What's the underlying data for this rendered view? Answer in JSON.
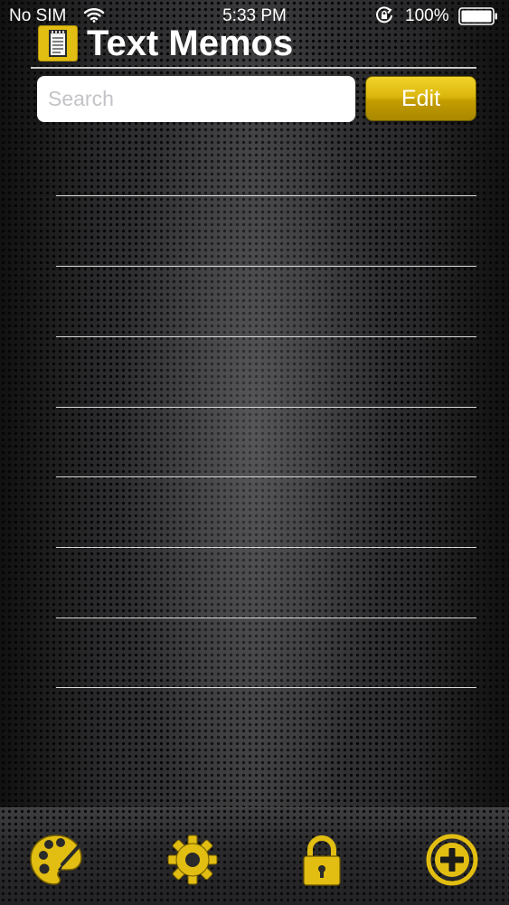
{
  "status_bar": {
    "carrier": "No SIM",
    "time": "5:33 PM",
    "battery": "100%",
    "icons": [
      "wifi-icon",
      "rotation-lock-icon",
      "battery-icon"
    ]
  },
  "header": {
    "title": "Text Memos",
    "icon": "notepad-icon"
  },
  "search": {
    "placeholder": "Search",
    "value": ""
  },
  "toolbar_top": {
    "edit_label": "Edit"
  },
  "memos": {
    "rows": [
      "",
      "",
      "",
      "",
      "",
      "",
      "",
      ""
    ]
  },
  "toolbar": {
    "icons": [
      "palette-icon",
      "gear-icon",
      "padlock-icon",
      "plus-circle-icon"
    ]
  },
  "colors": {
    "accent": "#e2bd12",
    "accent_dark": "#a98700",
    "background": "#1d1d1f",
    "rule": "#d8d8d8"
  }
}
